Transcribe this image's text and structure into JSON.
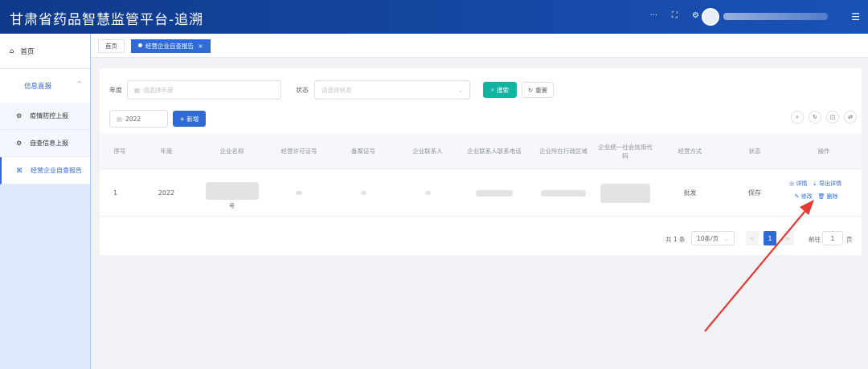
{
  "app": {
    "title": "甘肃省药品智慧监管平台-追溯"
  },
  "header": {
    "icons": [
      "more-icon",
      "fullscreen-icon",
      "settings-icon"
    ],
    "more_glyph": "···",
    "fullscreen_glyph": "⛶",
    "settings_glyph": "⚙",
    "menu_glyph": "☰"
  },
  "sidebar": {
    "home": {
      "label": "首页",
      "icon": "⌂"
    },
    "group": {
      "label": "信息直报",
      "chevron": "^"
    },
    "items": [
      {
        "label": "疫情防控上报",
        "icon": "⚙",
        "active": false
      },
      {
        "label": "自查信息上报",
        "icon": "⚙",
        "active": false
      },
      {
        "label": "经营企业自查报告",
        "icon": "⌘",
        "active": true
      }
    ]
  },
  "tabs": [
    {
      "label": "首页",
      "active": false
    },
    {
      "label": "经营企业自查报告",
      "active": true,
      "close": "×"
    }
  ],
  "filters": {
    "year_label": "年度",
    "year_placeholder": "请选择年度",
    "status_label": "状态",
    "status_placeholder": "请选择状态",
    "search_label": "搜索",
    "reset_label": "重置",
    "year_value": "2022",
    "add_label": "+ 新增"
  },
  "table": {
    "headers": [
      "序号",
      "年度",
      "企业名称",
      "经营许可证号",
      "备案证号",
      "企业联系人",
      "企业联系人联系电话",
      "企业所在行政区域",
      "企业统一社会信用代码",
      "经营方式",
      "状态",
      "操作"
    ],
    "rows": [
      {
        "index": "1",
        "year": "2022",
        "name_tail": "号",
        "mode": "批发",
        "status": "保存"
      }
    ],
    "ops": {
      "detail": "◎ 详情",
      "export": "⇣ 导出详情",
      "edit": "✎ 修改",
      "delete": "🗑 删除"
    }
  },
  "pagination": {
    "total": "共 1 条",
    "page_size": "10条/页",
    "prev": "<",
    "current": "1",
    "next": ">",
    "goto_label": "前往",
    "goto_value": "1",
    "page_suffix": "页"
  },
  "colors": {
    "header": "#1a52b8",
    "primary": "#2f6ad6",
    "teal": "#13b3a2",
    "arrow": "#e53935"
  }
}
